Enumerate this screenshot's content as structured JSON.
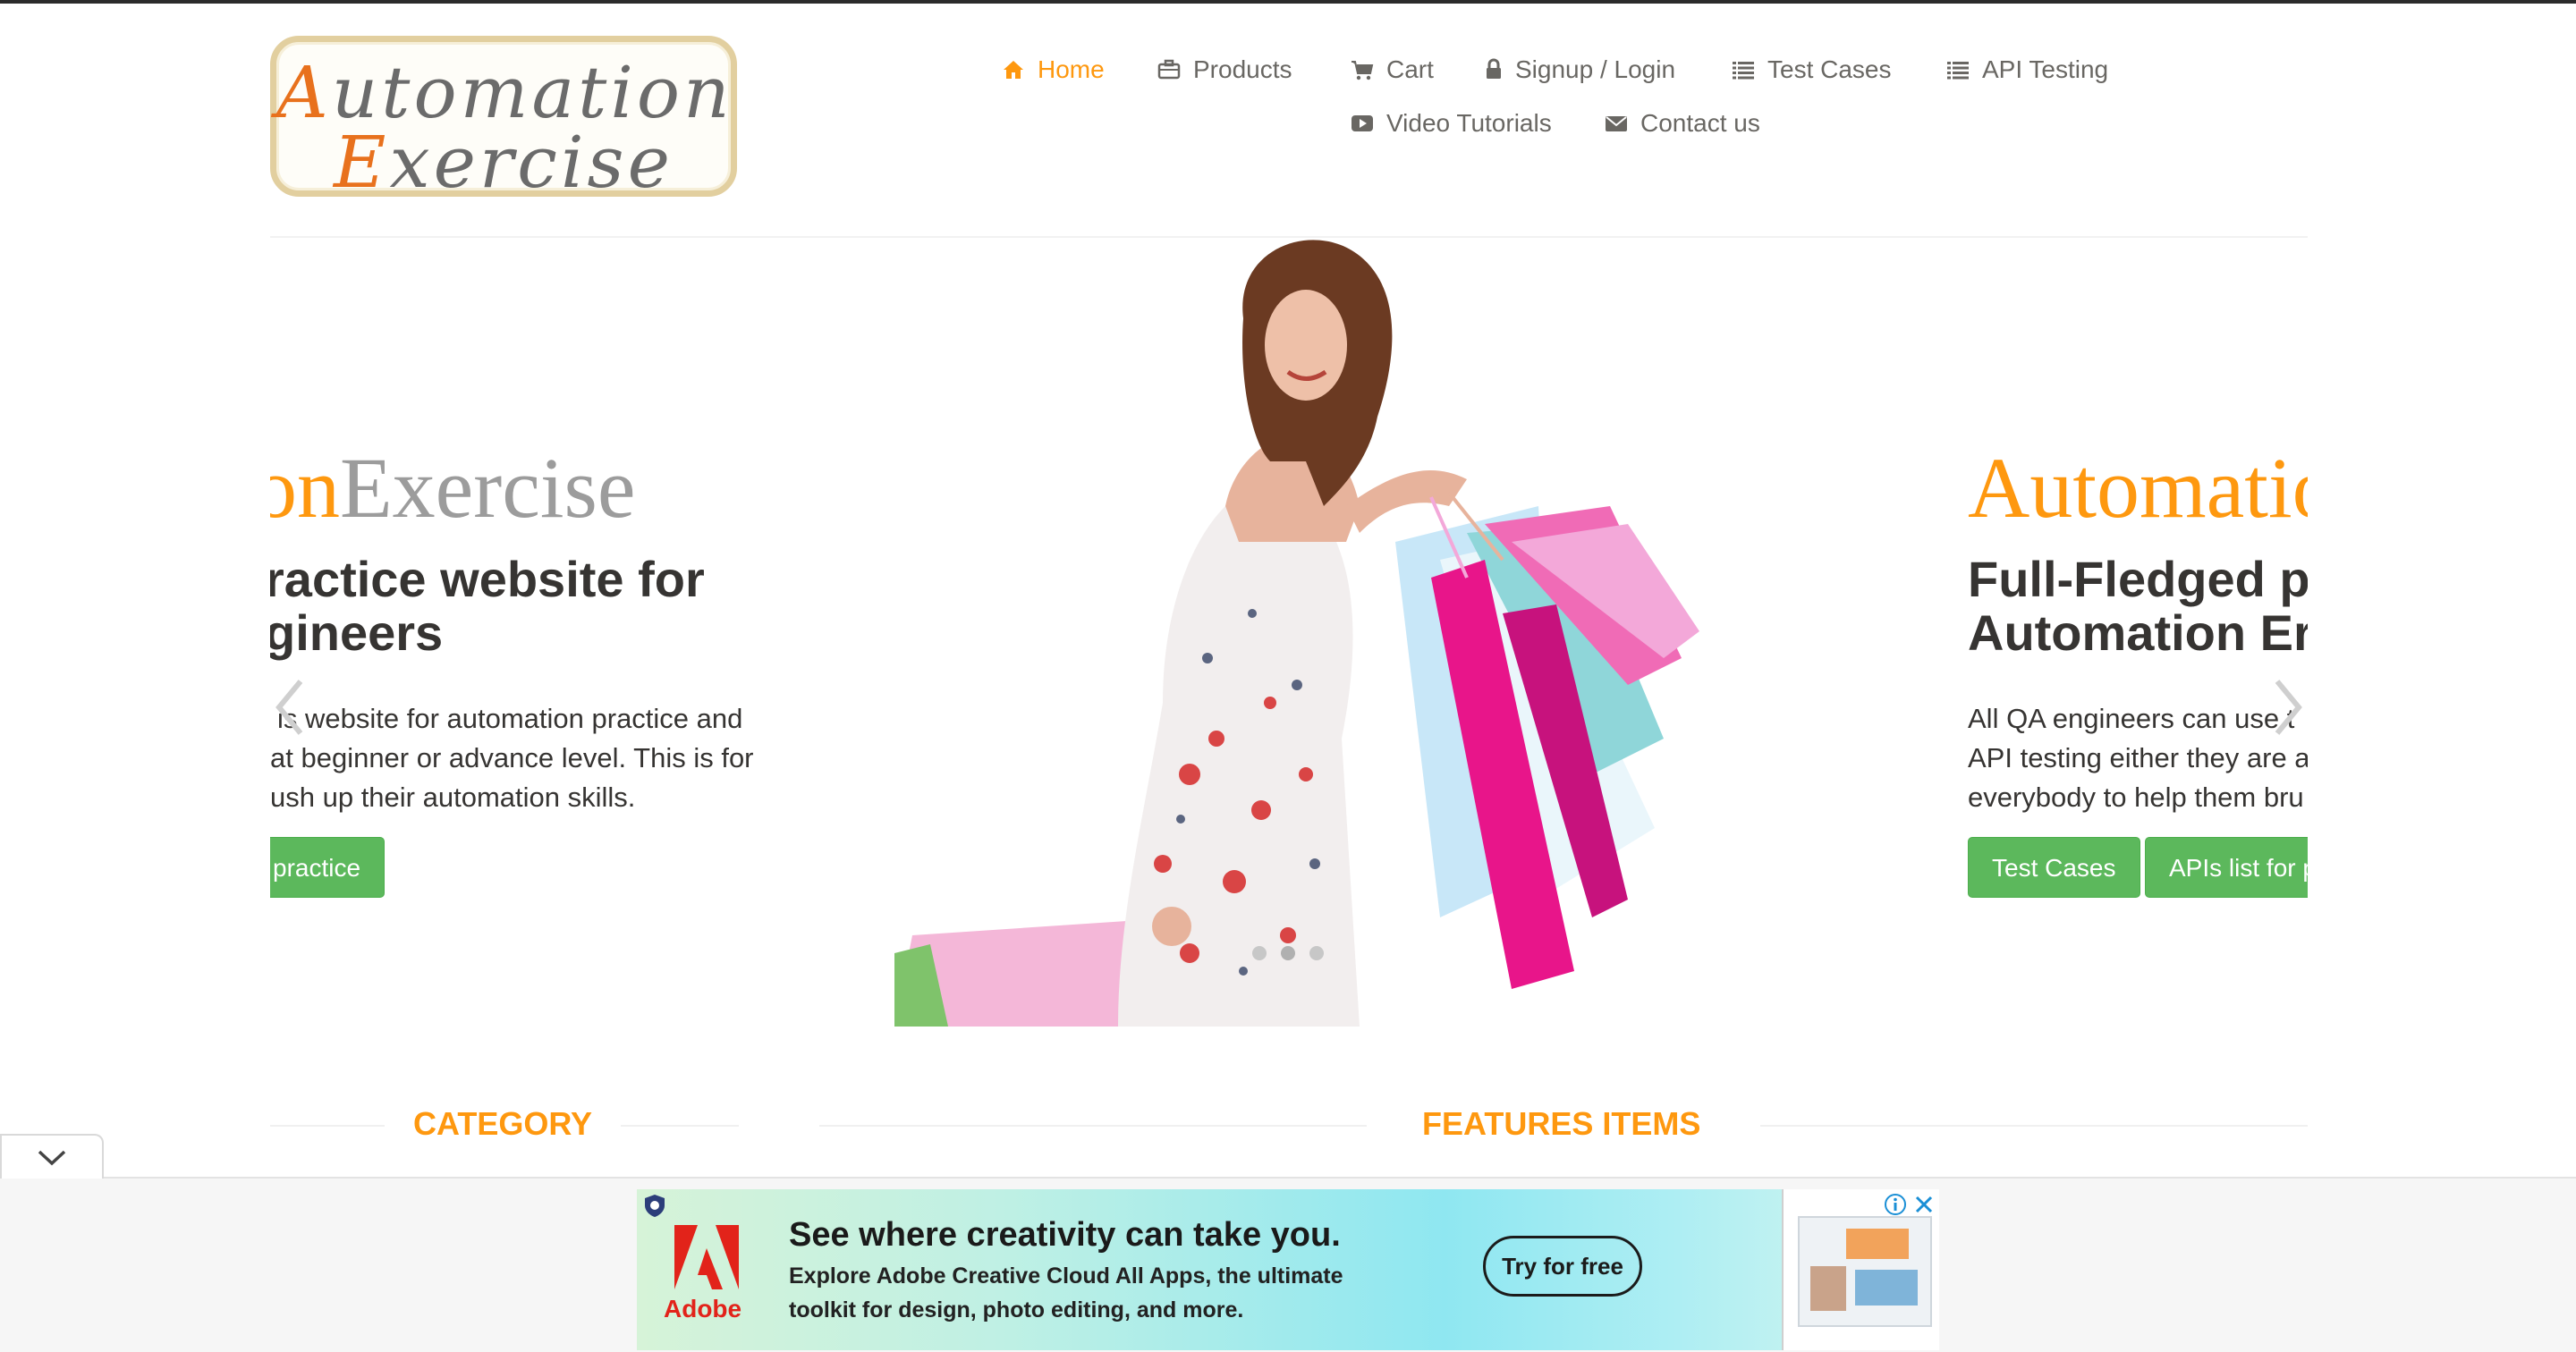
{
  "logo": {
    "line1_cap": "A",
    "line1_rest": "utomation",
    "line2_cap": "E",
    "line2_rest": "xercise"
  },
  "nav": {
    "items": [
      {
        "label": "Home",
        "icon": "home-icon",
        "active": true
      },
      {
        "label": "Products",
        "icon": "briefcase-icon"
      },
      {
        "label": "Cart",
        "icon": "cart-icon"
      },
      {
        "label": "Signup / Login",
        "icon": "lock-icon"
      },
      {
        "label": "Test Cases",
        "icon": "list-icon"
      },
      {
        "label": "API Testing",
        "icon": "list-icon"
      },
      {
        "label": "Video Tutorials",
        "icon": "youtube-icon"
      },
      {
        "label": "Contact us",
        "icon": "envelope-icon"
      }
    ]
  },
  "slider": {
    "left_slide": {
      "brand_orange": "on",
      "brand_grey": "Exercise",
      "heading_line1": "ractice website for",
      "heading_line2": "gineers",
      "para_line1": "is website for automation practice and",
      "para_line2": "at beginner or advance level. This is for",
      "para_line3": "ush up their automation skills.",
      "button": "practice"
    },
    "right_slide": {
      "brand": "Automatio",
      "heading_line1": "Full-Fledged p",
      "heading_line2": "Automation Er",
      "para_line1": "All QA engineers can use t",
      "para_line2": "API testing either they are a",
      "para_line3": "everybody to help them bru",
      "button1": "Test Cases",
      "button2": "APIs list for p"
    },
    "active_dot": 1,
    "dot_count": 3
  },
  "sections": {
    "category": "CATEGORY",
    "features": "FEATURES ITEMS"
  },
  "ad": {
    "title": "See where creativity can take you.",
    "sub_line1": "Explore Adobe Creative Cloud All Apps, the ultimate",
    "sub_line2": "toolkit for design, photo editing, and more.",
    "button": "Try for free",
    "brand": "Adobe"
  },
  "colors": {
    "accent": "#fe980f",
    "green": "#5cb85c",
    "text": "#363432",
    "adobe_red": "#e2231a"
  }
}
